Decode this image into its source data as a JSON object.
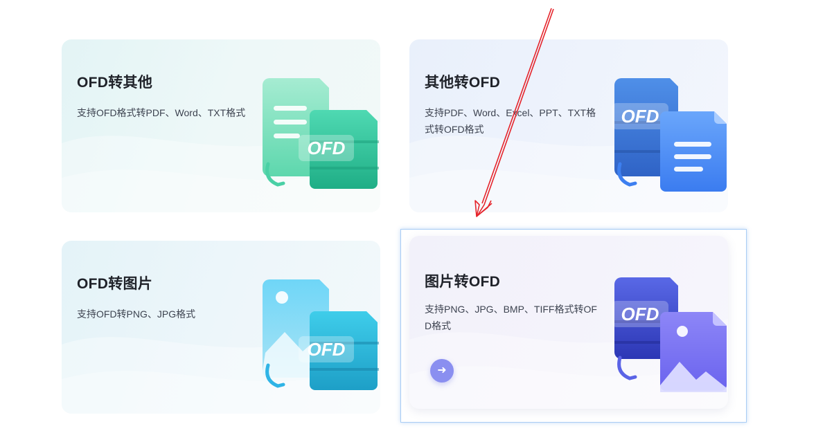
{
  "cards": [
    {
      "title": "OFD转其他",
      "desc": "支持OFD格式转PDF、Word、TXT格式",
      "badge": "OFD"
    },
    {
      "title": "其他转OFD",
      "desc": "支持PDF、Word、Excel、PPT、TXT格式转OFD格式",
      "badge": "OFD"
    },
    {
      "title": "OFD转图片",
      "desc": "支持OFD转PNG、JPG格式",
      "badge": "OFD"
    },
    {
      "title": "图片转OFD",
      "desc": "支持PNG、JPG、BMP、TIFF格式转OFD格式",
      "badge": "OFD",
      "action_icon": "arrow-right-icon"
    }
  ],
  "colors": {
    "green": "#2ed3a0",
    "blue": "#4d8df6",
    "cyan": "#2cc0dd",
    "indigo": "#5a63e6",
    "annotation": "#e5242b",
    "hover_border": "#a9cdf5"
  }
}
